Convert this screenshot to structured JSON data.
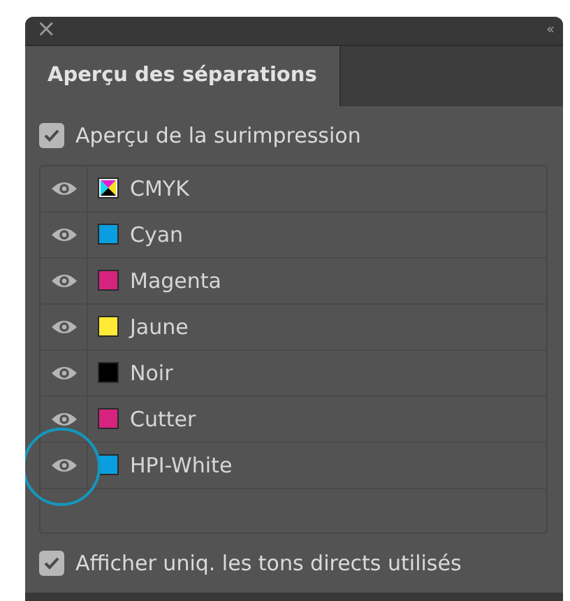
{
  "window": {
    "close": "×",
    "collapse": "‹‹"
  },
  "tabs": [
    {
      "label": "Aperçu des séparations",
      "selected": true
    }
  ],
  "overprint_preview": {
    "label": "Aperçu de la surimpression",
    "checked": true
  },
  "separations": [
    {
      "kind": "composite",
      "name": "CMYK",
      "visible": true,
      "highlighted": false
    },
    {
      "kind": "ink",
      "name": "Cyan",
      "color": "#0a9ee0",
      "visible": true,
      "highlighted": false
    },
    {
      "kind": "ink",
      "name": "Magenta",
      "color": "#d6237f",
      "visible": true,
      "highlighted": false
    },
    {
      "kind": "ink",
      "name": "Jaune",
      "color": "#ffe936",
      "visible": true,
      "highlighted": false
    },
    {
      "kind": "ink",
      "name": "Noir",
      "color": "#000000",
      "visible": true,
      "highlighted": false
    },
    {
      "kind": "ink",
      "name": "Cutter",
      "color": "#d6237f",
      "visible": true,
      "highlighted": false
    },
    {
      "kind": "ink",
      "name": "HPI-White",
      "color": "#0a9ee0",
      "visible": true,
      "highlighted": true
    }
  ],
  "used_spots_only": {
    "label": "Afficher uniq. les tons directs utilisés",
    "checked": true
  }
}
